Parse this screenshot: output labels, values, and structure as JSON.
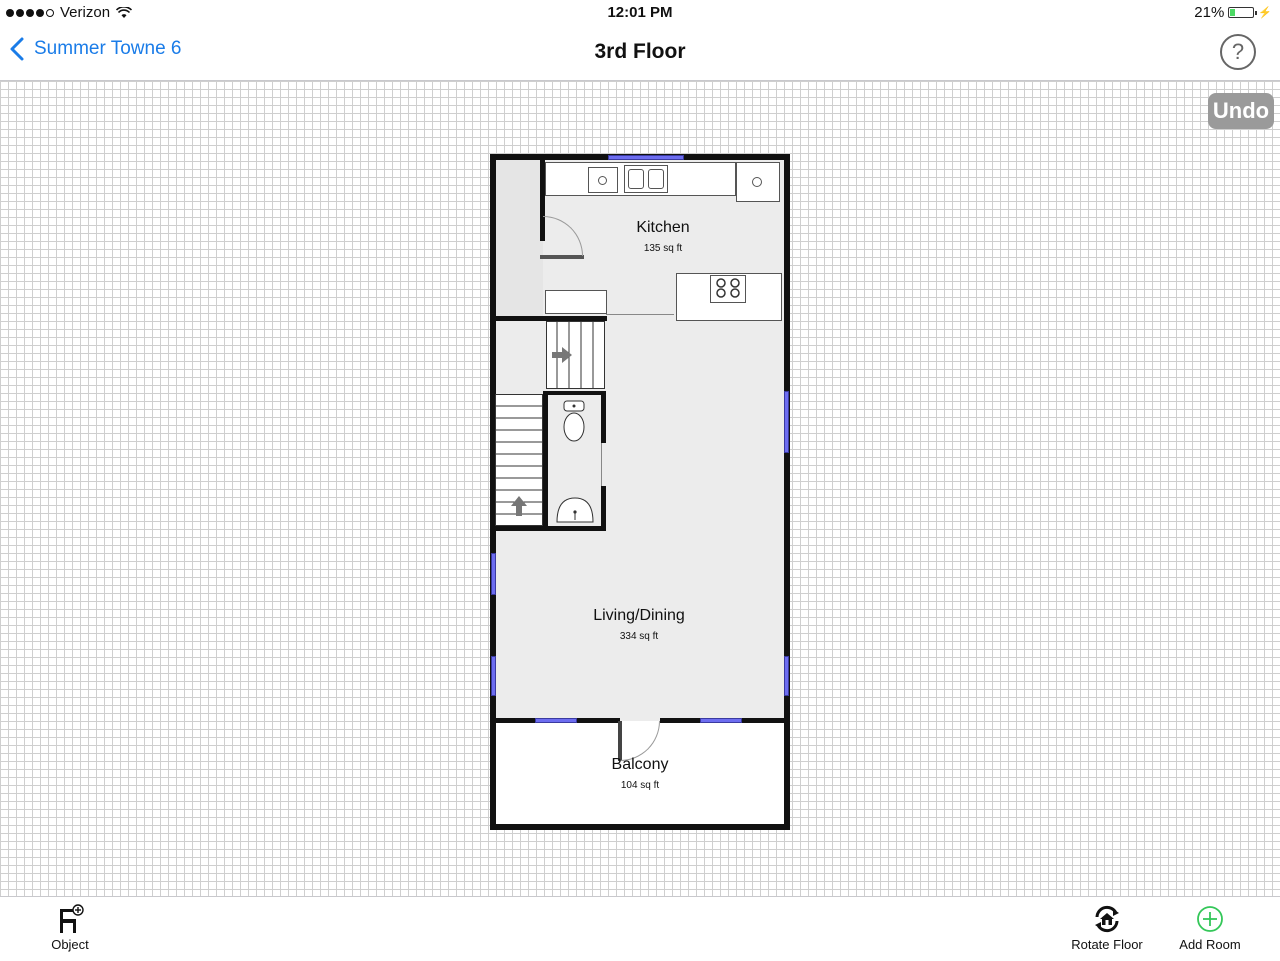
{
  "status": {
    "carrier": "Verizon",
    "time": "12:01 PM",
    "battery": "21%",
    "battery_level": 0.21
  },
  "nav": {
    "back_label": "Summer Towne 6",
    "title": "3rd Floor",
    "help": "?"
  },
  "canvas": {
    "undo_label": "Undo"
  },
  "rooms": [
    {
      "name": "Kitchen",
      "area": "135 sq ft"
    },
    {
      "name": "Living/Dining",
      "area": "334 sq ft"
    },
    {
      "name": "Balcony",
      "area": "104 sq ft"
    }
  ],
  "toolbar": {
    "object_label": "Object",
    "rotate_label": "Rotate Floor",
    "add_room_label": "Add Room"
  },
  "colors": {
    "accent": "#1a7ce8",
    "add_room": "#34c759",
    "window": "#6d6df0"
  },
  "icons": [
    "wifi-icon",
    "battery-icon",
    "chevron-left-icon",
    "help-icon",
    "chair-add-icon",
    "rotate-house-icon",
    "plus-circle-icon"
  ]
}
